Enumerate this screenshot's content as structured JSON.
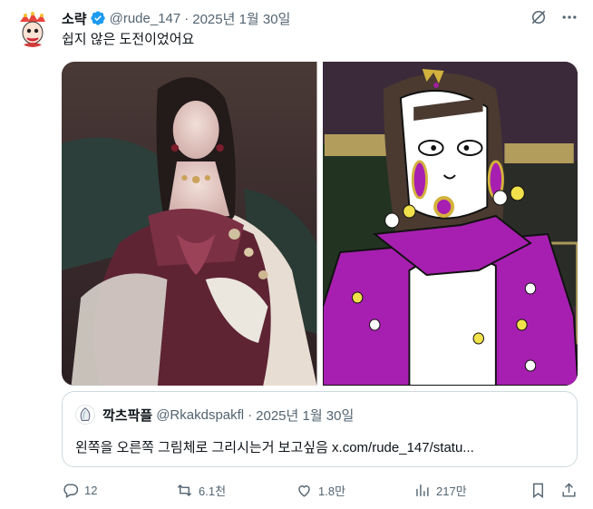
{
  "tweet": {
    "display_name": "소략",
    "handle": "@rude_147",
    "separator": "·",
    "date": "2025년 1월 30일",
    "text": "쉽지 않은 도전이었어요",
    "verified_icon": "verified-badge-icon",
    "avatar_icon": "avatar"
  },
  "top_icons": [
    "grok-icon",
    "more-icon"
  ],
  "media": {
    "left_image": "painted-portrait-image",
    "right_image": "mspaint-redraw-image"
  },
  "quote": {
    "display_name": "깍츠팍플",
    "handle": "@Rkakdspakfl",
    "separator": "·",
    "date": "2025년 1월 30일",
    "text": "왼쪽을 오른쪽 그림체로 그리시는거 보고싶음 x.com/rude_147/statu..."
  },
  "actions": {
    "replies": "12",
    "reposts": "6.1천",
    "likes": "1.8만",
    "views": "217만"
  },
  "colors": {
    "text_primary": "#0f1419",
    "text_secondary": "#536471",
    "verified_blue": "#1d9bf0",
    "border": "#cfd9de"
  }
}
